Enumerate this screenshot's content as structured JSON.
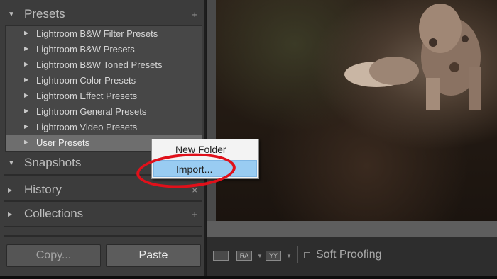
{
  "left_panel": {
    "presets_title": "Presets",
    "presets_plus": "+",
    "presets": [
      "Lightroom B&W Filter Presets",
      "Lightroom B&W Presets",
      "Lightroom B&W Toned Presets",
      "Lightroom Color Presets",
      "Lightroom Effect Presets",
      "Lightroom General Presets",
      "Lightroom Video Presets",
      "User Presets"
    ],
    "selected_preset": "User Presets",
    "snapshots_title": "Snapshots",
    "history_title": "History",
    "history_close": "×",
    "collections_title": "Collections",
    "collections_plus": "+",
    "copy_label": "Copy...",
    "paste_label": "Paste"
  },
  "context_menu": {
    "items": [
      "New Folder",
      "Import..."
    ],
    "highlighted": "Import..."
  },
  "toolbar": {
    "soft_proofing_label": "Soft Proofing",
    "compare_label": "RA",
    "survey_label": "YY"
  },
  "icons": {
    "expanded": "triangle-down",
    "collapsed": "triangle-right",
    "folder": "triangle-right"
  },
  "colors": {
    "annotation": "#e0101a",
    "menu_hover": "#99ccf2"
  }
}
